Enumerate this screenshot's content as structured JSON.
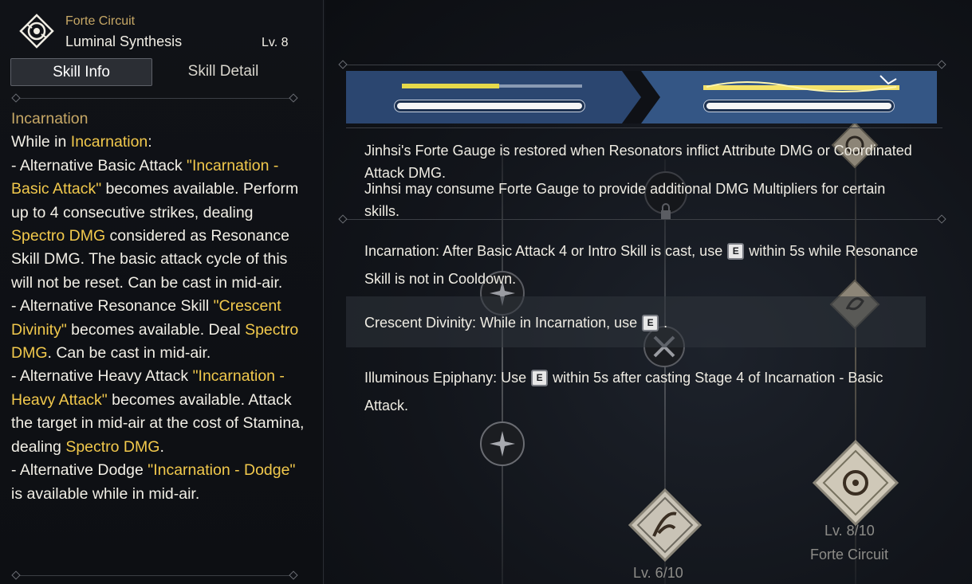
{
  "header": {
    "subtitle": "Forte Circuit",
    "title": "Luminal Synthesis",
    "level": "Lv. 8"
  },
  "tabs": {
    "info": "Skill Info",
    "detail": "Skill Detail"
  },
  "description": {
    "title": "Incarnation",
    "p0a": "While in ",
    "p0b": "Incarnation",
    "p0c": ":",
    "p1a": "- Alternative Basic Attack ",
    "p1b": "\"Incarnation - Basic Attack\"",
    "p1c": " becomes available. Perform up to 4 consecutive strikes, dealing ",
    "p1d": "Spectro DMG",
    "p1e": " considered as Resonance Skill DMG. The basic attack cycle of this will not be reset. Can be cast in mid-air.",
    "p2a": "- Alternative Resonance Skill ",
    "p2b": "\"Crescent Divinity\"",
    "p2c": " becomes available. Deal ",
    "p2d": "Spectro DMG",
    "p2e": ". Can be cast in mid-air.",
    "p3a": "- Alternative Heavy Attack ",
    "p3b": "\"Incarnation - Heavy Attack\"",
    "p3c": " becomes available. Attack the target in mid-air at the cost of Stamina, dealing ",
    "p3d": "Spectro DMG",
    "p3e": ".",
    "p4a": "- Alternative Dodge ",
    "p4b": "\"Incarnation - Dodge\"",
    "p4c": " is available while in mid-air."
  },
  "gauge": {
    "line1": "Jinhsi's Forte Gauge is restored when Resonators inflict Attribute DMG or Coordinated Attack DMG.",
    "line2": "Jinhsi may consume Forte Gauge to provide additional DMG Multipliers for certain skills."
  },
  "details": {
    "incarnation_a": "Incarnation: After Basic Attack 4 or Intro Skill is cast, use",
    "incarnation_b": "within 5s while Resonance Skill is not in Cooldown.",
    "crescent_a": "Crescent Divinity: While in Incarnation, use",
    "crescent_b": ".",
    "illuminous_a": "Illuminous Epiphany: Use",
    "illuminous_b": "within 5s after casting Stage 4 of Incarnation - Basic Attack.",
    "key": "E"
  },
  "tree": {
    "node_right_level": "Lv. 8/10",
    "node_right_label": "Forte Circuit",
    "node_center_level": "Lv. 6/10"
  },
  "colors": {
    "accent_gold": "#c7a866",
    "highlight_yellow": "#f2c94c",
    "banner_blue": "#2b4670"
  }
}
